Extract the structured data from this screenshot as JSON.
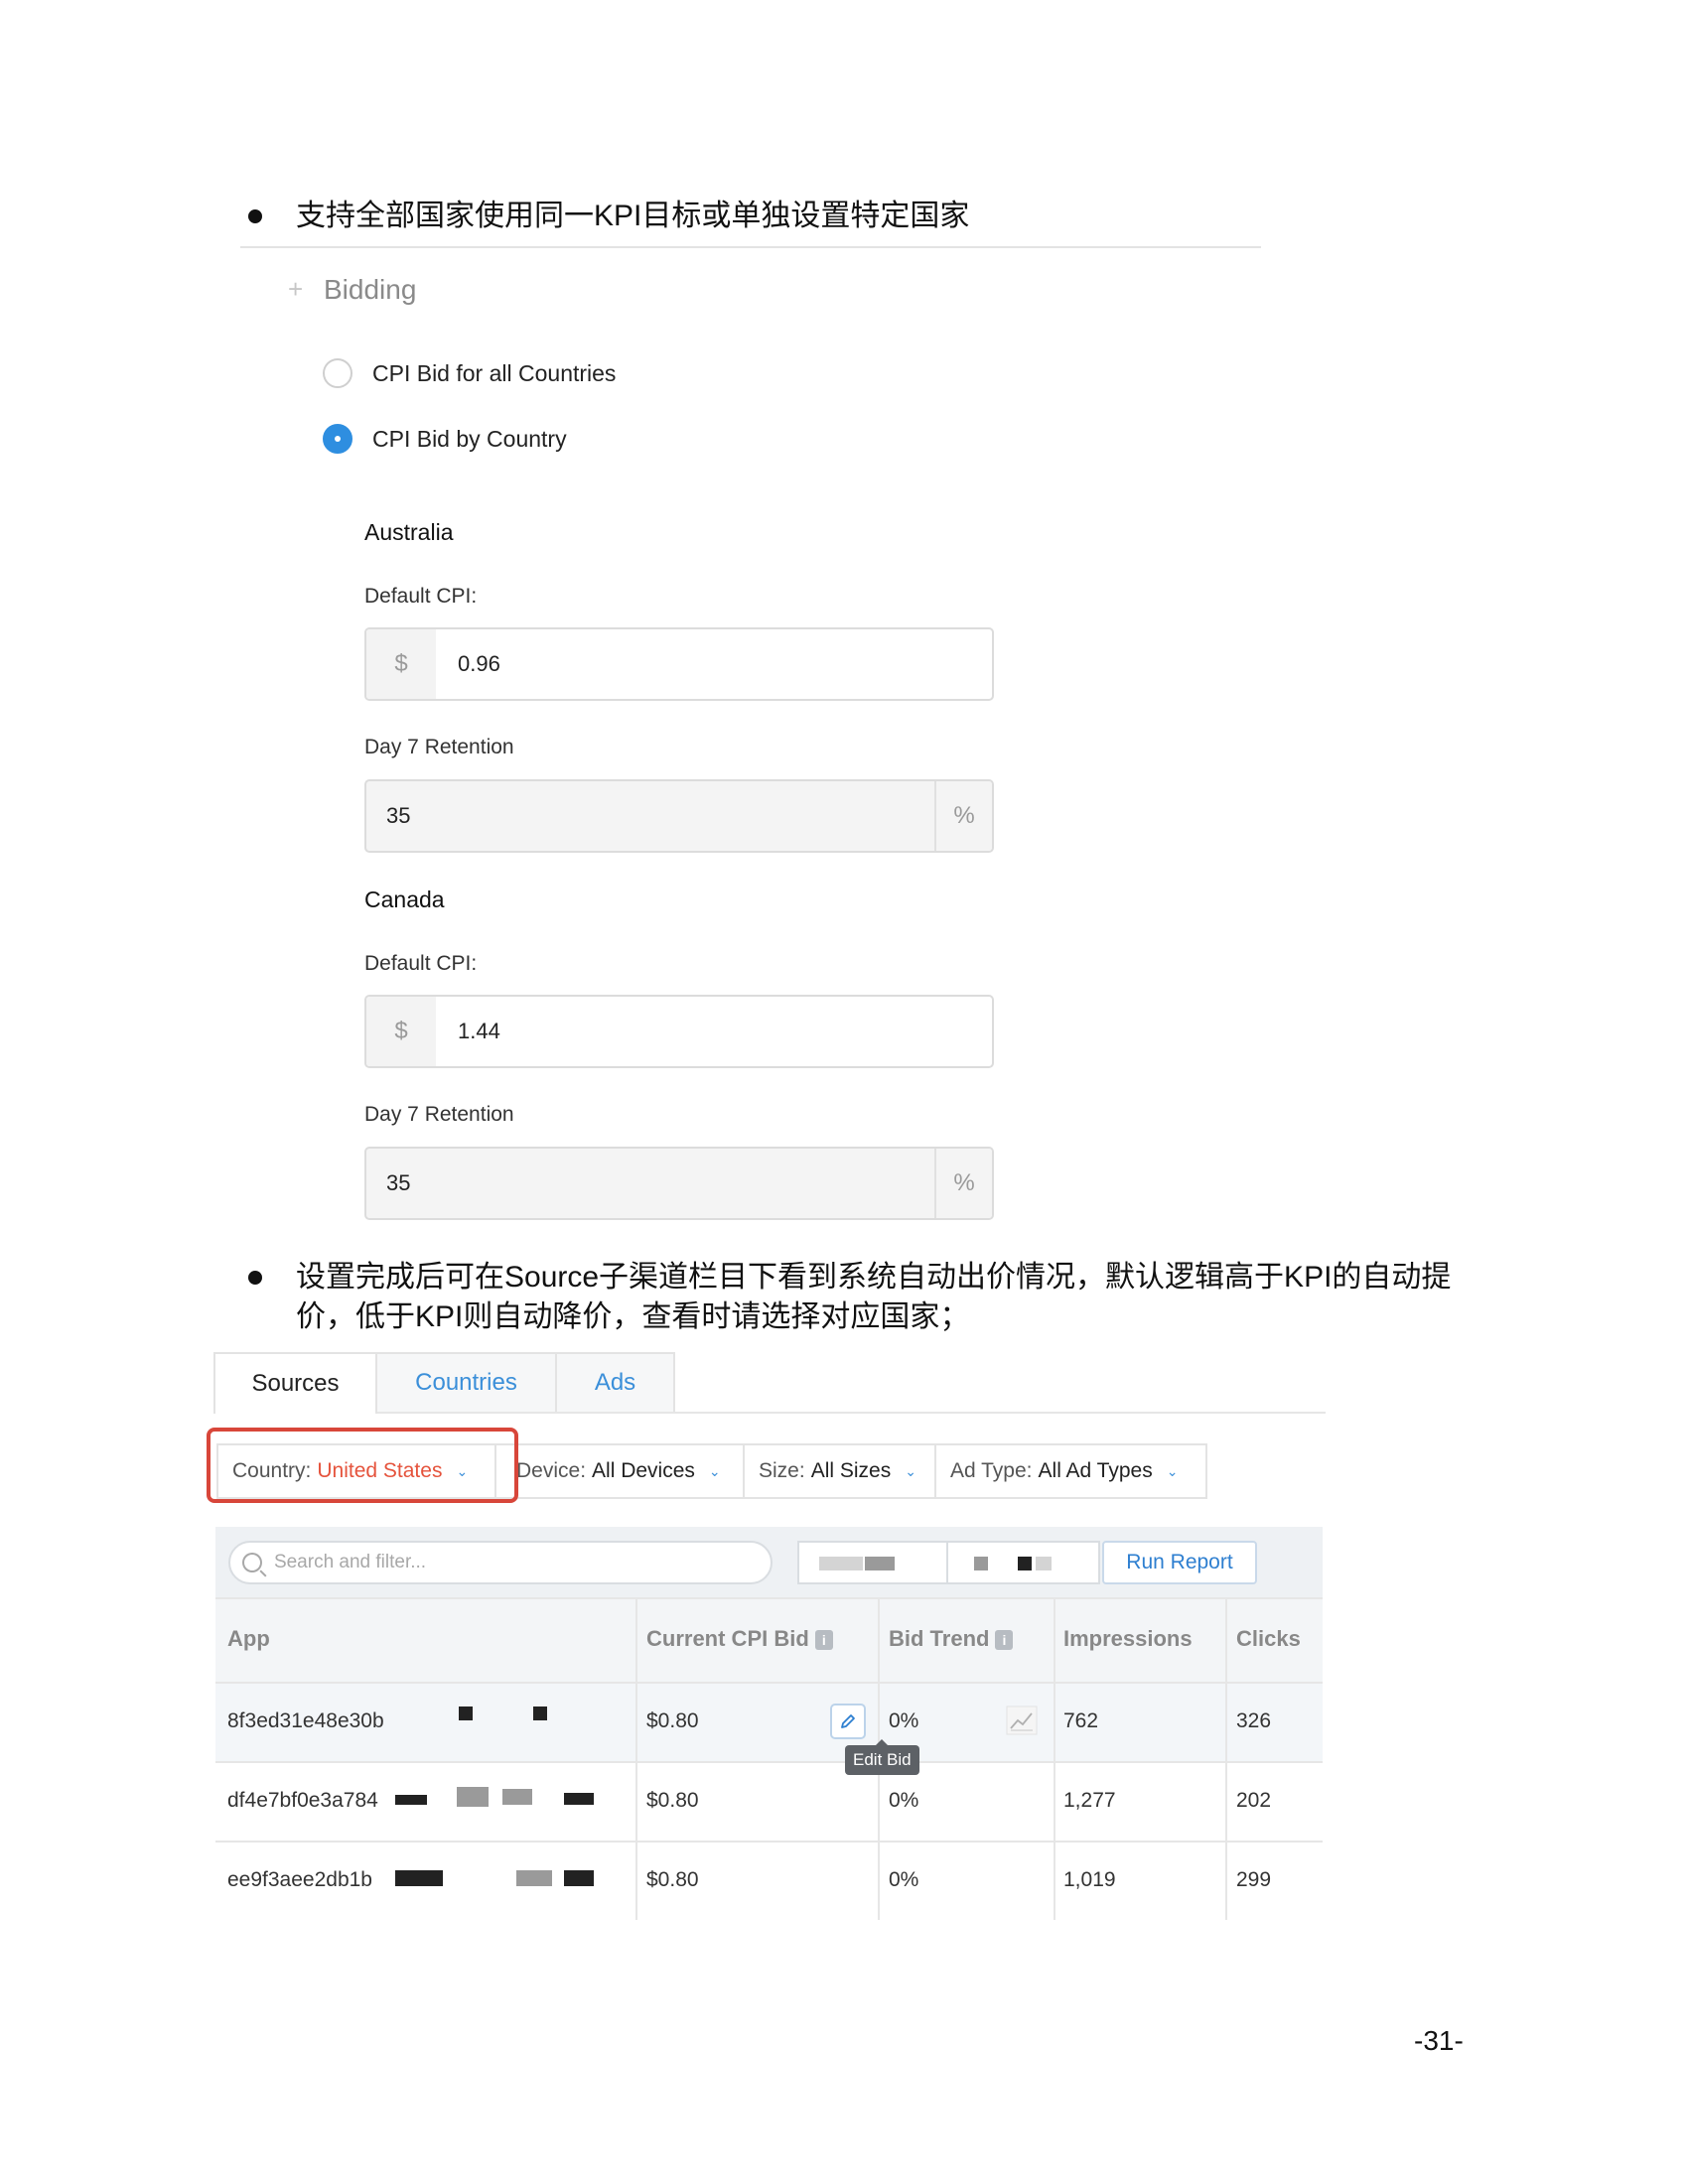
{
  "bullets": {
    "first": "支持全部国家使用同一KPI目标或单独设置特定国家",
    "second_line1": "设置完成后可在Source子渠道栏目下看到系统自动出价情况，默认逻辑高于KPI的自动提",
    "second_line2": "价，低于KPI则自动降价，查看时请选择对应国家；"
  },
  "bidding": {
    "plus": "+",
    "title": "Bidding",
    "options": [
      {
        "label": "CPI Bid for all Countries",
        "selected": false
      },
      {
        "label": "CPI Bid by Country",
        "selected": true
      }
    ],
    "countries": [
      {
        "name": "Australia",
        "cpi_label": "Default CPI:",
        "currency": "$",
        "cpi_value": "0.96",
        "retention_label": "Day 7 Retention",
        "retention_value": "35",
        "percent": "%"
      },
      {
        "name": "Canada",
        "cpi_label": "Default CPI:",
        "currency": "$",
        "cpi_value": "1.44",
        "retention_label": "Day 7 Retention",
        "retention_value": "35",
        "percent": "%"
      }
    ]
  },
  "report": {
    "tabs": [
      "Sources",
      "Countries",
      "Ads"
    ],
    "active_tab": "Sources",
    "filters": [
      {
        "label": "Country:",
        "value": "United States"
      },
      {
        "label": "Device:",
        "value": "All Devices"
      },
      {
        "label": "Size:",
        "value": "All Sizes"
      },
      {
        "label": "Ad Type:",
        "value": "All Ad Types"
      }
    ],
    "search_placeholder": "Search and filter...",
    "run_report": "Run Report",
    "columns": [
      "App",
      "Current CPI Bid",
      "Bid Trend",
      "Impressions",
      "Clicks"
    ],
    "info_glyph": "i",
    "rows": [
      {
        "app": "8f3ed31e48e30b",
        "bid": "$0.80",
        "trend": "0%",
        "impressions": "762",
        "clicks": "326"
      },
      {
        "app": "df4e7bf0e3a784",
        "bid": "$0.80",
        "trend": "0%",
        "impressions": "1,277",
        "clicks": "202"
      },
      {
        "app": "ee9f3aee2db1b",
        "bid": "$0.80",
        "trend": "0%",
        "impressions": "1,019",
        "clicks": "299"
      }
    ],
    "tooltip": "Edit Bid"
  },
  "page_number": "-31-",
  "colors": {
    "accent": "#2e8ee0",
    "highlight": "#d8463a",
    "country_value": "#e5533c"
  }
}
